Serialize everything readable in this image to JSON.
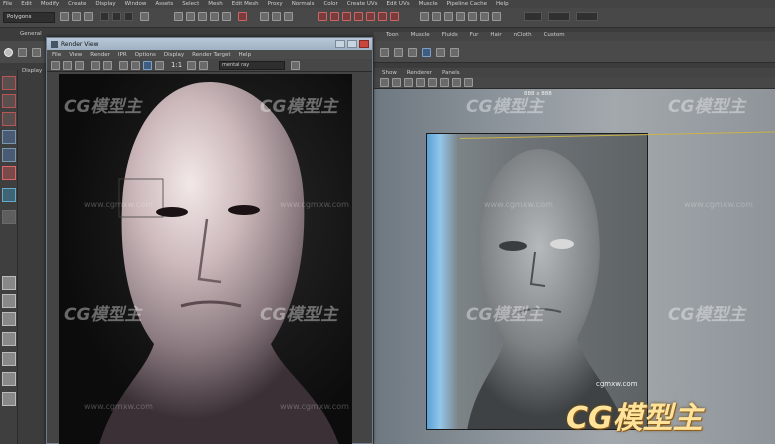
{
  "menubar": [
    "File",
    "Edit",
    "Modify",
    "Create",
    "Display",
    "Window",
    "Assets",
    "Select",
    "Mesh",
    "Edit Mesh",
    "Proxy",
    "Normals",
    "Color",
    "Create UVs",
    "Edit UVs",
    "Muscle",
    "Pipeline Cache",
    "Help"
  ],
  "mode_select": "Polygons",
  "left_shelf_label": "General",
  "toolbox_label": "Display",
  "shelf_tabs": [
    "Toon",
    "Muscle",
    "Fluids",
    "Fur",
    "Hair",
    "nCloth",
    "Custom"
  ],
  "viewport": {
    "menu": [
      "Show",
      "Renderer",
      "Panels"
    ],
    "resolution": "888 x 888"
  },
  "render_view": {
    "title": "Render View",
    "menu": [
      "File",
      "View",
      "Render",
      "IPR",
      "Options",
      "Display",
      "Render Target",
      "Help"
    ],
    "ratio": "1:1",
    "camera": "mental ray"
  },
  "watermark": {
    "brand": "CG模型主",
    "url": "www.cgmxw.com",
    "url_small": "cgmxw.com"
  },
  "colors": {
    "titlebar": "#a9bacb",
    "accent": "#c9b34a",
    "logo": "#ffe39a"
  }
}
